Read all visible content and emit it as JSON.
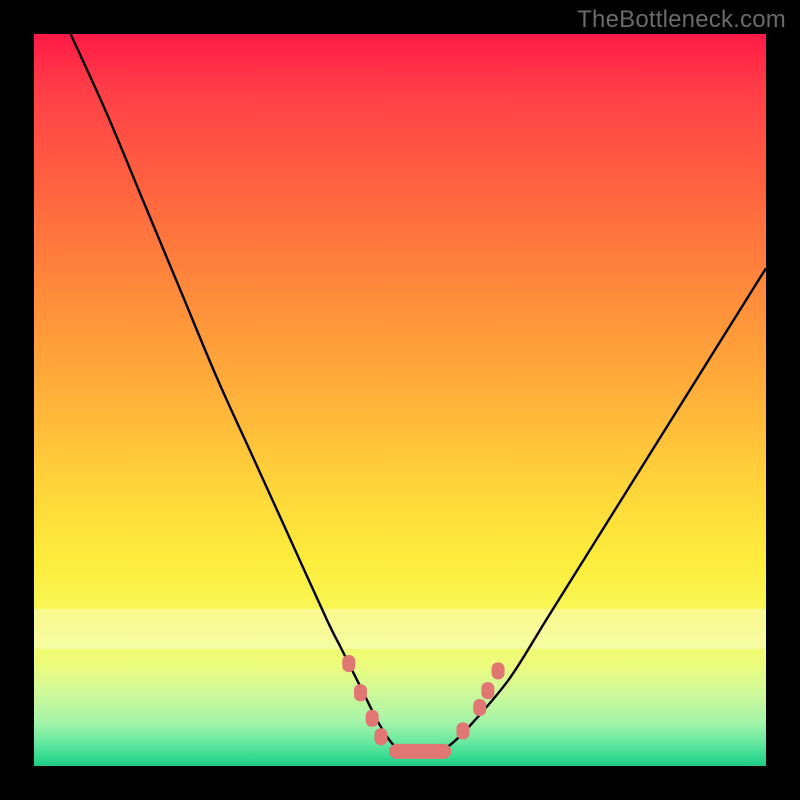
{
  "watermark": "TheBottleneck.com",
  "chart_data": {
    "type": "line",
    "title": "",
    "xlabel": "",
    "ylabel": "",
    "xlim": [
      0,
      100
    ],
    "ylim": [
      0,
      100
    ],
    "grid": false,
    "legend": false,
    "series": [
      {
        "name": "bottleneck-curve",
        "color": "#000000",
        "x": [
          5,
          10,
          15,
          20,
          25,
          30,
          35,
          40,
          42,
          45,
          47,
          49,
          51,
          53,
          55,
          57,
          60,
          65,
          70,
          75,
          80,
          85,
          90,
          95,
          100
        ],
        "y": [
          100,
          89,
          77,
          65,
          53,
          42,
          31,
          20,
          16,
          10,
          6,
          3,
          2,
          2,
          2,
          3,
          6,
          12,
          20,
          28,
          36,
          44,
          52,
          60,
          68
        ]
      }
    ],
    "markers": [
      {
        "name": "left-dots",
        "color": "#e07772",
        "shape": "rounded",
        "points": [
          {
            "x": 43.0,
            "y": 14.0
          },
          {
            "x": 44.6,
            "y": 10.0
          },
          {
            "x": 46.2,
            "y": 6.5
          },
          {
            "x": 47.4,
            "y": 4.0
          }
        ]
      },
      {
        "name": "bottom-pill",
        "color": "#e07772",
        "shape": "pill",
        "x_range": [
          48.5,
          57.0
        ],
        "y": 2.0
      },
      {
        "name": "right-dots",
        "color": "#e07772",
        "shape": "rounded",
        "points": [
          {
            "x": 58.6,
            "y": 4.8
          },
          {
            "x": 60.9,
            "y": 8.0
          },
          {
            "x": 62.0,
            "y": 10.3
          },
          {
            "x": 63.4,
            "y": 13.0
          }
        ]
      }
    ]
  }
}
